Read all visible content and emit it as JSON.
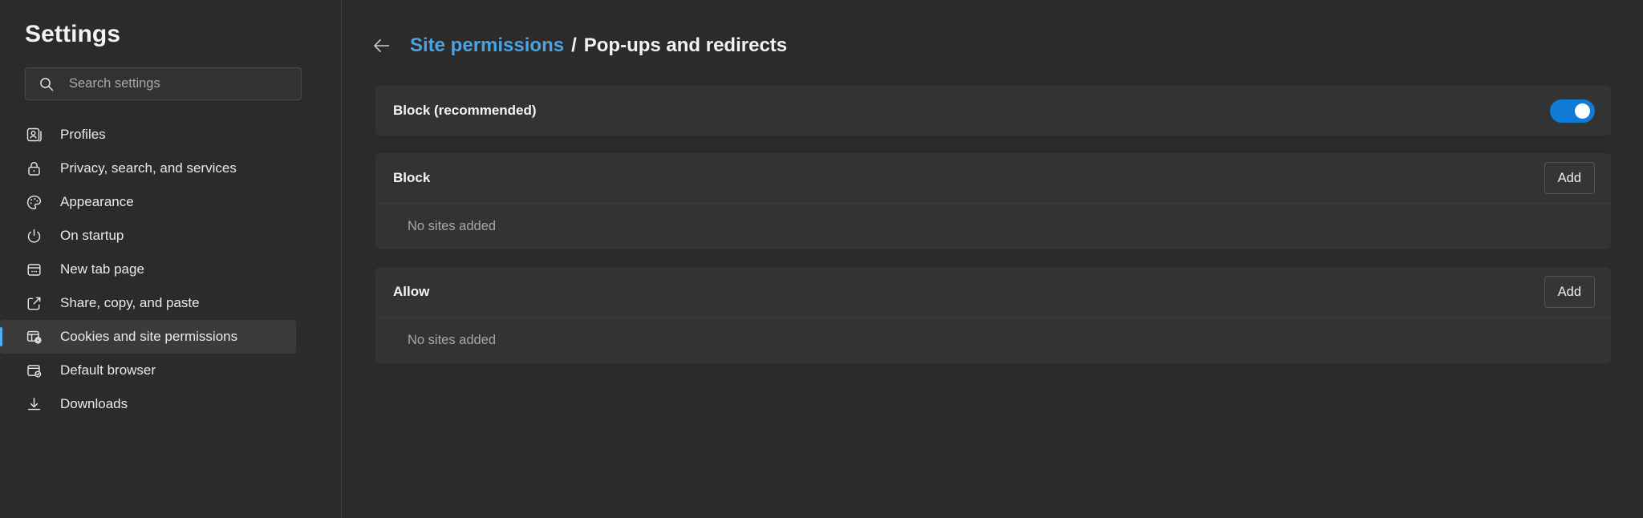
{
  "sidebar": {
    "title": "Settings",
    "search": {
      "placeholder": "Search settings",
      "value": "",
      "icon": "search-icon"
    },
    "items": [
      {
        "label": "Profiles",
        "icon": "profile-card-icon",
        "selected": false
      },
      {
        "label": "Privacy, search, and services",
        "icon": "lock-icon",
        "selected": false
      },
      {
        "label": "Appearance",
        "icon": "palette-icon",
        "selected": false
      },
      {
        "label": "On startup",
        "icon": "power-icon",
        "selected": false
      },
      {
        "label": "New tab page",
        "icon": "new-tab-page-icon",
        "selected": false
      },
      {
        "label": "Share, copy, and paste",
        "icon": "share-icon",
        "selected": false
      },
      {
        "label": "Cookies and site permissions",
        "icon": "cookies-settings-icon",
        "selected": true
      },
      {
        "label": "Default browser",
        "icon": "default-browser-icon",
        "selected": false
      },
      {
        "label": "Downloads",
        "icon": "download-icon",
        "selected": false
      }
    ]
  },
  "header": {
    "back_icon": "back-arrow-icon",
    "parent_label": "Site permissions",
    "separator": "/",
    "current_label": "Pop-ups and redirects"
  },
  "main": {
    "block_recommended": {
      "label": "Block (recommended)",
      "toggle_on": true
    },
    "block_section": {
      "title": "Block",
      "add_label": "Add",
      "empty_text": "No sites added"
    },
    "allow_section": {
      "title": "Allow",
      "add_label": "Add",
      "empty_text": "No sites added"
    }
  },
  "colors": {
    "accent": "#0f7bd4",
    "link": "#4aa3e0",
    "selected_bar": "#4cb0f5",
    "page_bg": "#2b2b2b",
    "card_bg": "#333333"
  }
}
